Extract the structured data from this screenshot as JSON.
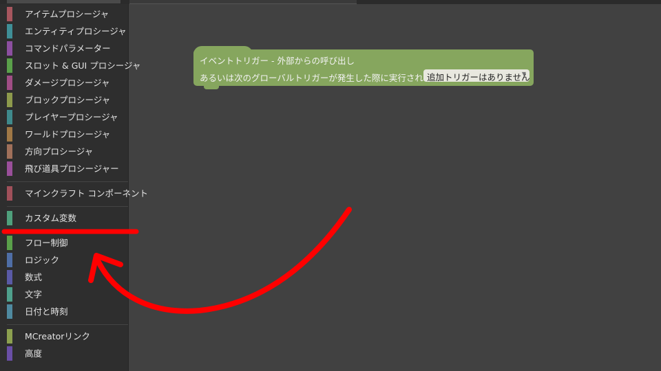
{
  "sidebar": {
    "groups": [
      {
        "items": [
          {
            "label": "アイテムプロシージャ",
            "color": "#a7565e"
          },
          {
            "label": "エンティティプロシージャ",
            "color": "#3f8f97"
          },
          {
            "label": "コマンドパラメーター",
            "color": "#8c4fa0"
          },
          {
            "label": "スロット & GUI プロシージャ",
            "color": "#5aa04a"
          },
          {
            "label": "ダメージプロシージャ",
            "color": "#a04d85"
          },
          {
            "label": "ブロックプロシージャ",
            "color": "#8d9a4c"
          },
          {
            "label": "プレイヤープロシージャ",
            "color": "#3f8a8c"
          },
          {
            "label": "ワールドプロシージャ",
            "color": "#a07846"
          },
          {
            "label": "方向プロシージャ",
            "color": "#a0705a"
          },
          {
            "label": "飛び道具プロシージャー",
            "color": "#9a4f9a"
          }
        ]
      },
      {
        "items": [
          {
            "label": "マインクラフト コンポーネント",
            "color": "#a0505a"
          }
        ]
      },
      {
        "items": [
          {
            "label": "カスタム変数",
            "color": "#4fa07c"
          }
        ]
      },
      {
        "items": [
          {
            "label": "フロー制御",
            "color": "#5aa04a"
          },
          {
            "label": "ロジック",
            "color": "#4f6ea6"
          },
          {
            "label": "数式",
            "color": "#5a5aa6"
          },
          {
            "label": "文字",
            "color": "#4fa08c"
          },
          {
            "label": "日付と時刻",
            "color": "#4f8aa0"
          }
        ]
      },
      {
        "items": [
          {
            "label": "MCreatorリンク",
            "color": "#8ca04f"
          },
          {
            "label": "高度",
            "color": "#6a4fa6"
          }
        ]
      }
    ]
  },
  "event_block": {
    "title": "イベントトリガー - 外部からの呼び出し",
    "trigger_text": "あるいは次のグローバルトリガーが発生した際に実行される:",
    "trigger_dropdown": "追加トリガーはありません",
    "color": "#86a65e"
  },
  "annotation": {
    "color": "#ff0000",
    "icons": [
      "underline-highlight",
      "curved-arrow"
    ]
  }
}
